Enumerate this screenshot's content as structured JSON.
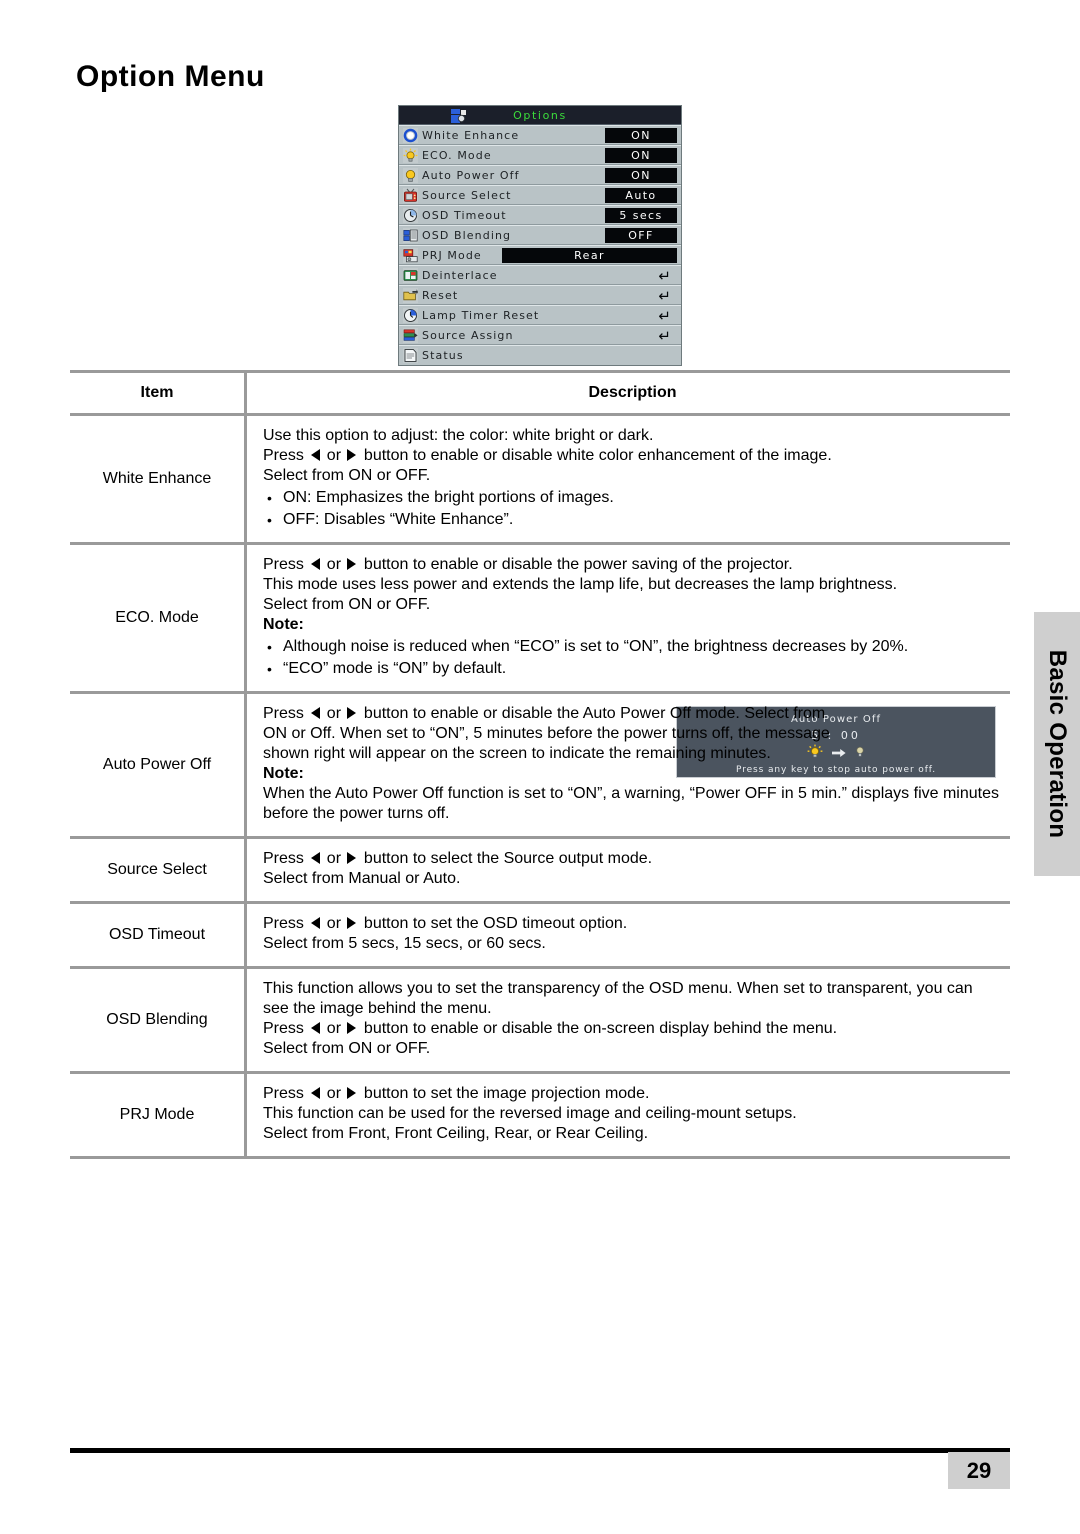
{
  "page": {
    "title": "Option Menu",
    "number": "29",
    "side_tab_label": "Basic Operation"
  },
  "osd": {
    "title": "Options",
    "title_icon": "options-window-icon",
    "rows": [
      {
        "icon": "white-enhance-ring-icon",
        "label": "White Enhance",
        "value": "ON",
        "value_width": "narrow"
      },
      {
        "icon": "eco-lamp-icon",
        "label": "ECO. Mode",
        "value": "ON",
        "value_width": "narrow"
      },
      {
        "icon": "bulb-icon",
        "label": "Auto Power Off",
        "value": "ON",
        "value_width": "narrow"
      },
      {
        "icon": "tv-source-icon",
        "label": "Source Select",
        "value": "Auto",
        "value_width": "narrow"
      },
      {
        "icon": "clock-icon",
        "label": "OSD Timeout",
        "value": "5 secs",
        "value_width": "narrow"
      },
      {
        "icon": "osd-blending-icon",
        "label": "OSD Blending",
        "value": "OFF",
        "value_width": "narrow"
      },
      {
        "icon": "prj-mode-icon",
        "label": "PRJ Mode",
        "value": "Rear",
        "value_width": "wide"
      },
      {
        "icon": "deinterlace-icon",
        "label": "Deinterlace",
        "value": "",
        "enter": "↵"
      },
      {
        "icon": "reset-folder-icon",
        "label": "Reset",
        "value": "",
        "enter": "↵"
      },
      {
        "icon": "lamp-timer-icon",
        "label": "Lamp Timer Reset",
        "value": "",
        "enter": "↵"
      },
      {
        "icon": "source-assign-icon",
        "label": "Source Assign",
        "value": "",
        "enter": "↵"
      },
      {
        "icon": "status-page-icon",
        "label": "Status",
        "value": ""
      }
    ]
  },
  "apo_inset": {
    "title": "Auto Power Off",
    "timer": "5 : 00",
    "lamp_on_icon": "lamp-on-icon",
    "arrow_icon": "right-arrow-icon",
    "lamp_off_icon": "lamp-off-icon",
    "note": "Press any key to stop auto power off."
  },
  "table": {
    "headers": {
      "item": "Item",
      "description": "Description"
    },
    "rows": [
      {
        "item": "White Enhance",
        "lines": [
          {
            "type": "text",
            "a": "Use this option to adjust: the color: white bright or dark."
          },
          {
            "type": "press",
            "a": "Press ",
            "b": " or ",
            "c": " button to enable or disable white color enhancement of the image."
          },
          {
            "type": "text",
            "a": "Select from ON or OFF."
          },
          {
            "type": "bullet",
            "a": "ON: Emphasizes the bright portions of images."
          },
          {
            "type": "bullet",
            "a": "OFF: Disables “White Enhance”."
          }
        ]
      },
      {
        "item": "ECO. Mode",
        "lines": [
          {
            "type": "press",
            "a": "Press ",
            "b": " or ",
            "c": " button to enable or disable the power saving of the projector."
          },
          {
            "type": "text",
            "a": "This mode uses less power and extends the lamp life, but decreases the lamp brightness."
          },
          {
            "type": "text",
            "a": "Select from ON or OFF."
          },
          {
            "type": "note",
            "a": "Note:"
          },
          {
            "type": "bullet",
            "a": "Although noise is reduced when “ECO” is set to “ON”, the brightness decreases by 20%."
          },
          {
            "type": "bullet",
            "a": "“ECO” mode is “ON” by default."
          }
        ]
      },
      {
        "item": "Auto Power Off",
        "has_inset": true,
        "lines": [
          {
            "type": "press-narrow",
            "a": "Press ",
            "b": " or ",
            "c": " button to enable or disable the Auto Power Off mode. Select from ON or Off. When set to “ON”, 5 minutes before the power turns off, the message shown right will appear on the screen to indicate the remaining minutes."
          },
          {
            "type": "note",
            "a": "Note:"
          },
          {
            "type": "text-wrap",
            "a": "When the Auto Power Off function is set to “ON”, a warning, “Power OFF in 5 min.” displays five minutes before the power turns off."
          }
        ]
      },
      {
        "item": "Source Select",
        "lines": [
          {
            "type": "press",
            "a": "Press ",
            "b": " or ",
            "c": " button to select the Source output mode."
          },
          {
            "type": "text",
            "a": "Select from Manual or Auto."
          }
        ]
      },
      {
        "item": "OSD Timeout",
        "lines": [
          {
            "type": "press",
            "a": "Press ",
            "b": " or ",
            "c": " button to set the OSD timeout option."
          },
          {
            "type": "text",
            "a": "Select from 5 secs, 15 secs, or 60 secs."
          }
        ]
      },
      {
        "item": "OSD Blending",
        "lines": [
          {
            "type": "text-wrap",
            "a": "This function allows you to set the transparency of the OSD menu. When set to transparent, you can see the image behind the menu."
          },
          {
            "type": "press",
            "a": "Press ",
            "b": " or ",
            "c": " button to enable or disable the on-screen display behind the menu."
          },
          {
            "type": "text",
            "a": "Select from ON or OFF."
          }
        ]
      },
      {
        "item": "PRJ Mode",
        "lines": [
          {
            "type": "press",
            "a": "Press ",
            "b": " or ",
            "c": " button to set the image projection mode."
          },
          {
            "type": "text",
            "a": "This function can be used for the reversed image and ceiling-mount setups."
          },
          {
            "type": "text",
            "a": "Select from Front, Front Ceiling, Rear, or Rear Ceiling."
          }
        ]
      }
    ]
  }
}
